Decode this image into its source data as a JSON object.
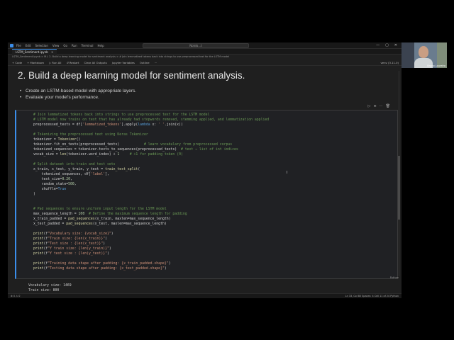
{
  "titlebar": {
    "menus": [
      "File",
      "Edit",
      "Selection",
      "View",
      "Go",
      "Run",
      "Terminal",
      "Help"
    ],
    "search": "Noteb...t",
    "controls": [
      "—",
      "▢",
      "✕"
    ]
  },
  "tab": {
    "label": "LSTM_Sentiment.ipynb",
    "close": "✕"
  },
  "breadcrumb": "LSTM_Sentiment.ipynb > M↓ 2. Build a deep learning model for sentiment analysis > # Join lemmatized tokens back into strings to use preprocessed text for the LSTM model",
  "toolbar": {
    "items": [
      "+ Code",
      "+ Markdown",
      "▷ Run All",
      "↺ Restart",
      "Clear All Outputs",
      "Jupyter Variables",
      "Outline",
      "···"
    ],
    "kernel": "venv (3.11.0)"
  },
  "markdown": {
    "heading": "2. Build a deep learning model for sentiment analysis.",
    "bullets": [
      "Create an LSTM-based model with appropriate layers.",
      "Evaluate your model's performance."
    ]
  },
  "cell_toolbar_icons": [
    "▷",
    "≡",
    "⋯",
    "🗑"
  ],
  "code_lines": [
    "# Join lemmatized tokens back into strings to use preprocessed text for the LSTM model",
    "# LSTM model now trains on text that has already had stopwords removed, stemming applied, and lemmatization applied",
    "preprocessed_texts = df['lemmatized_tokens'].apply(lambda x: ' '.join(x))",
    "",
    "# Tokenizing the preprocessed text using Keras Tokenizer",
    "tokenizer = Tokenizer()",
    "tokenizer.fit_on_texts(preprocessed_texts)            # learn vocabulary from preprocessed corpus",
    "tokenized_sequences = tokenizer.texts_to_sequences(preprocessed_texts)  # text → list of int indices",
    "vocab_size = len(tokenizer.word_index) + 1     # +1 for padding token (0)",
    "",
    "# Split dataset into train and test sets",
    "x_train, x_test, y_train, y_test = train_test_split(",
    "    tokenized_sequences, df['label'],",
    "    test_size=0.20,",
    "    random_state=500,",
    "    shuffle=True",
    ")",
    "",
    "",
    "# Pad sequences to ensure uniform input length for the LSTM model",
    "max_sequence_length = 100  # Define the maximum sequence length for padding",
    "x_train_padded = pad_sequences(x_train, maxlen=max_sequence_length)",
    "x_test_padded = pad_sequences(x_test, maxlen=max_sequence_length)",
    "",
    "print(f\"Vocabulary size: {vocab_size}\")",
    "print(f\"Train size: {len(x_train)}\")",
    "print(f\"Test size : {len(x_test)}\")",
    "print(f\"Y train size: {len(y_train)}\")",
    "print(f\"Y test size : {len(y_test)}\")",
    "",
    "print(f\"Training data shape after padding: {x_train_padded.shape}\")",
    "print(f\"Testing data shape after padding: {x_test_padded.shape}\")"
  ],
  "cell_language": "Python",
  "output_lines": [
    "Vocabulary size: 1469",
    "Train size: 800"
  ],
  "statusbar": {
    "left": "⊗ 0 ⚠ 0",
    "right": "Ln 33, Col 80   Spaces: 4   Cell 11 of 24   Python"
  },
  "webcam": {
    "name": "Bruno Loureiro"
  }
}
